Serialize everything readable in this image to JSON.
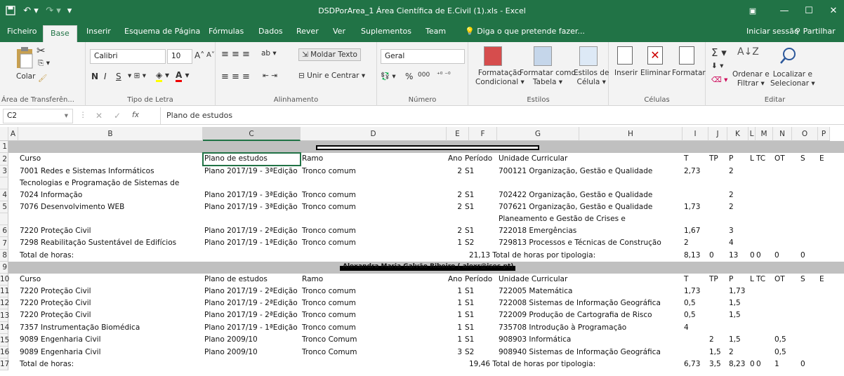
{
  "window": {
    "title": "DSDPorArea_1 Área Científica de E.Civil (1).xls - Excel",
    "save_icon": "save-icon",
    "undo_icon": "undo-icon",
    "redo_icon": "redo-icon"
  },
  "tabs": [
    {
      "label": "Ficheiro"
    },
    {
      "label": "Base"
    },
    {
      "label": "Inserir"
    },
    {
      "label": "Esquema de Página"
    },
    {
      "label": "Fórmulas"
    },
    {
      "label": "Dados"
    },
    {
      "label": "Rever"
    },
    {
      "label": "Ver"
    },
    {
      "label": "Suplementos"
    },
    {
      "label": "Team"
    },
    {
      "label": "Diga o que pretende fazer..."
    }
  ],
  "account": {
    "signin": "Iniciar sessão",
    "share": "Partilhar"
  },
  "ribbon": {
    "clipboard": {
      "paste": "Colar",
      "label": "Área de Transferên..."
    },
    "font": {
      "name": "Calibri",
      "size": "10",
      "bold": "N",
      "italic": "I",
      "underline": "S",
      "label": "Tipo de Letra"
    },
    "alignment": {
      "wrap": "Moldar Texto",
      "merge": "Unir e Centrar",
      "label": "Alinhamento"
    },
    "number": {
      "format": "Geral",
      "percent": "%",
      "thousands": "000",
      "label": "Número"
    },
    "styles": {
      "conditional_1": "Formatação",
      "conditional_2": "Condicional",
      "table_1": "Formatar como",
      "table_2": "Tabela",
      "cell_1": "Estilos de",
      "cell_2": "Célula",
      "label": "Estilos"
    },
    "cells": {
      "insert": "Inserir",
      "delete": "Eliminar",
      "format": "Formatar",
      "label": "Células"
    },
    "editing": {
      "sort_1": "Ordenar e",
      "sort_2": "Filtrar",
      "find_1": "Localizar e",
      "find_2": "Selecionar",
      "label": "Editar"
    }
  },
  "formula_bar": {
    "name_box": "C2",
    "fx": "fx",
    "content": "Plano de estudos"
  },
  "columns": [
    "A",
    "B",
    "C",
    "D",
    "E",
    "F",
    "G",
    "H",
    "I",
    "J",
    "K",
    "L",
    "M",
    "N",
    "O",
    "P"
  ],
  "rows": [
    {
      "n": "1"
    },
    {
      "n": "2",
      "a": "Curso",
      "c": "Plano de estudos",
      "d": "Ramo",
      "e": "Ano",
      "f": "Período",
      "g": "Unidade Curricular",
      "i": "T",
      "j": "TP",
      "k": "P",
      "l": "L",
      "m": "TC",
      "n2": "OT",
      "o": "S",
      "p": "E"
    },
    {
      "n": "3",
      "a": "7001 Redes e Sistemas Informáticos",
      "c": "Plano 2017/19 - 3ªEdição",
      "d": "Tronco comum",
      "e": "2",
      "f": "S1",
      "g": "700121 Organização, Gestão e Qualidade",
      "i": "2,73",
      "k": "2"
    },
    {
      "n": "",
      "a": "Tecnologias e Programação de Sistemas de"
    },
    {
      "n": "4",
      "a": "7024 Informação",
      "c": "Plano 2017/19 - 3ªEdição",
      "d": "Tronco comum",
      "e": "2",
      "f": "S1",
      "g": "702422 Organização, Gestão e Qualidade",
      "k": "2"
    },
    {
      "n": "5",
      "a": "7076 Desenvolvimento WEB",
      "c": "Plano 2017/19 - 3ªEdição",
      "d": "Tronco comum",
      "e": "2",
      "f": "S1",
      "g": "707621 Organização, Gestão e Qualidade",
      "i": "1,73",
      "k": "2"
    },
    {
      "n": "",
      "g": "Planeamento e Gestão de Crises e"
    },
    {
      "n": "6",
      "a": "7220 Proteção Civil",
      "c": "Plano 2017/19 - 2ªEdição",
      "d": "Tronco comum",
      "e": "2",
      "f": "S1",
      "g": "722018 Emergências",
      "i": "1,67",
      "k": "3"
    },
    {
      "n": "7",
      "a": "7298 Reabilitação Sustentável de Edifícios",
      "c": "Plano 2017/19 - 1ªEdição",
      "d": "Tronco comum",
      "e": "1",
      "f": "S2",
      "g": "729813 Processos e Técnicas de Construção",
      "i": "2",
      "k": "4"
    },
    {
      "n": "8",
      "a": "Total de horas:",
      "g": "21,13 Total de horas por tipologia:",
      "i": "8,13",
      "j": "0",
      "k": "13",
      "l": "0",
      "m": "0",
      "n2": "0",
      "o": "0"
    },
    {
      "n": "9",
      "d": "Alexandra Maria Galvão Ribeiro ( alexr@isec.pt)"
    },
    {
      "n": "10",
      "a": "Curso",
      "c": "Plano de estudos",
      "d": "Ramo",
      "e": "Ano",
      "f": "Período",
      "g": "Unidade Curricular",
      "i": "T",
      "j": "TP",
      "k": "P",
      "l": "L",
      "m": "TC",
      "n2": "OT",
      "o": "S",
      "p": "E"
    },
    {
      "n": "11",
      "a": "7220 Proteção Civil",
      "c": "Plano 2017/19 - 2ªEdição",
      "d": "Tronco comum",
      "e": "1",
      "f": "S1",
      "g": "722005 Matemática",
      "i": "1,73",
      "k": "1,73"
    },
    {
      "n": "12",
      "a": "7220 Proteção Civil",
      "c": "Plano 2017/19 - 2ªEdição",
      "d": "Tronco comum",
      "e": "1",
      "f": "S1",
      "g": "722008 Sistemas de Informação Geográfica",
      "i": "0,5",
      "k": "1,5"
    },
    {
      "n": "13",
      "a": "7220 Proteção Civil",
      "c": "Plano 2017/19 - 2ªEdição",
      "d": "Tronco comum",
      "e": "1",
      "f": "S1",
      "g": "722009 Produção de Cartografia de Risco",
      "i": "0,5",
      "k": "1,5"
    },
    {
      "n": "14",
      "a": "7357 Instrumentação Biomédica",
      "c": "Plano 2017/19 - 1ªEdição",
      "d": "Tronco comum",
      "e": "1",
      "f": "S1",
      "g": "735708 Introdução à Programação",
      "i": "4"
    },
    {
      "n": "15",
      "a": "9089 Engenharia Civil",
      "c": "Plano 2009/10",
      "d": "Tronco Comum",
      "e": "1",
      "f": "S1",
      "g": "908903 Informática",
      "j": "2",
      "k": "1,5",
      "n2": "0,5"
    },
    {
      "n": "16",
      "a": "9089 Engenharia Civil",
      "c": "Plano 2009/10",
      "d": "Tronco Comum",
      "e": "3",
      "f": "S2",
      "g": "908940 Sistemas de Informação Geográfica",
      "j": "1,5",
      "k": "2",
      "n2": "0,5"
    },
    {
      "n": "17",
      "a": "Total de horas:",
      "g": "19,46 Total de horas por tipologia:",
      "i": "6,73",
      "j": "3,5",
      "k": "8,23",
      "l": "0",
      "m": "0",
      "n2": "1",
      "o": "0"
    }
  ]
}
